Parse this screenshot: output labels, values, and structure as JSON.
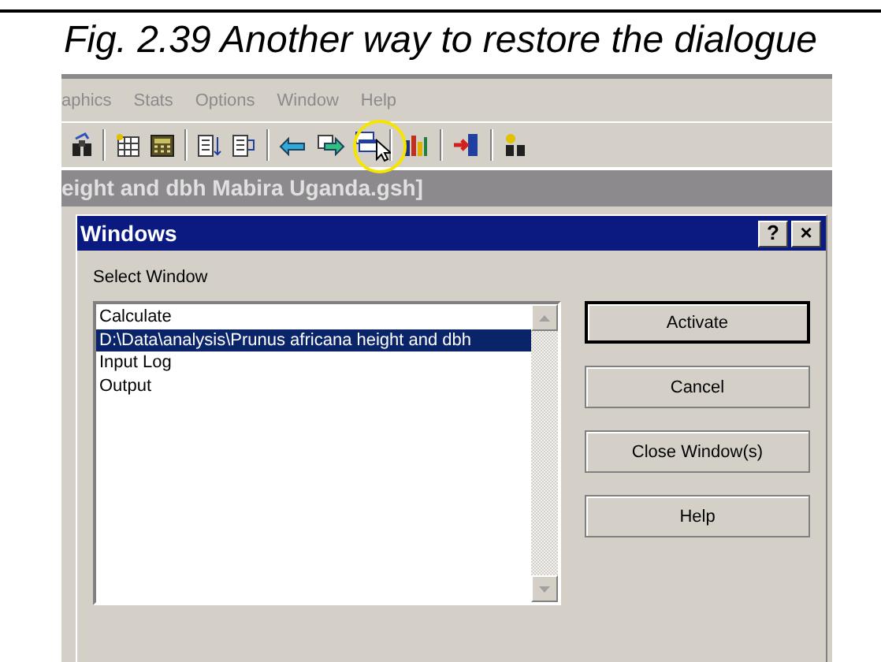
{
  "caption": "Fig. 2.39 Another way to restore the dialogue",
  "menu": [
    {
      "label": "aphics",
      "disabled": true
    },
    {
      "label": "Stats",
      "disabled": true
    },
    {
      "label": "Options",
      "disabled": true
    },
    {
      "label": "Window",
      "disabled": true
    },
    {
      "label": "Help",
      "disabled": true
    }
  ],
  "main_window": {
    "title": "eight and dbh Mabira Uganda.gsh]"
  },
  "dialog": {
    "title": "Windows",
    "title_buttons": [
      "?",
      "×"
    ],
    "prompt": "Select Window",
    "items": [
      {
        "label": "Calculate",
        "selected": false
      },
      {
        "label": "D:\\Data\\analysis\\Prunus africana height and dbh",
        "selected": true
      },
      {
        "label": "Input Log",
        "selected": false
      },
      {
        "label": "Output",
        "selected": false
      }
    ],
    "buttons": [
      {
        "label": "Activate",
        "default": true
      },
      {
        "label": "Cancel",
        "default": false
      },
      {
        "label": "Close Window(s)",
        "default": false
      },
      {
        "label": "Help",
        "default": false
      }
    ]
  }
}
